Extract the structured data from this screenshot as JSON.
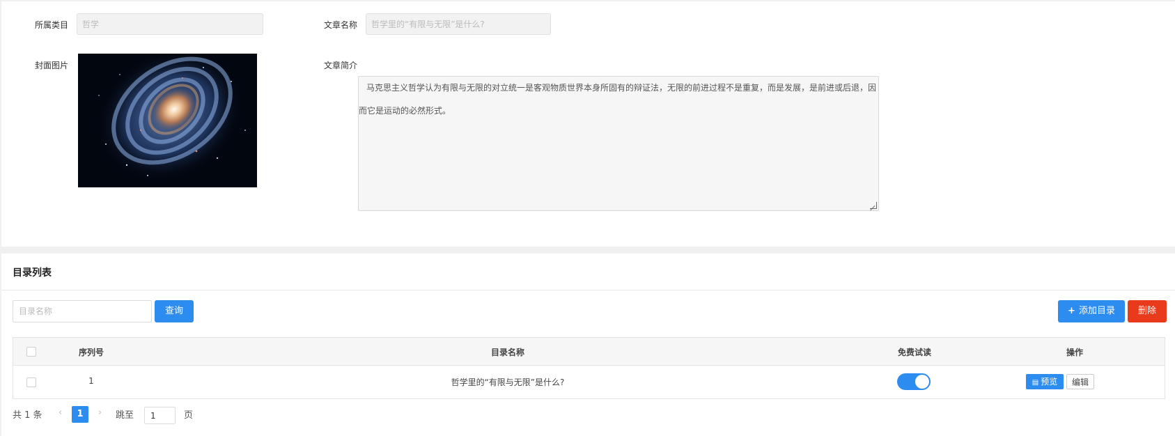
{
  "form": {
    "category_label": "所属类目",
    "category_value": "哲学",
    "title_label": "文章名称",
    "title_value": "哲学里的“有限与无限”是什么?",
    "cover_label": "封面图片",
    "intro_label": "文章简介",
    "intro_text": "马克思主义哲学认为有限与无限的对立统一是客观物质世界本身所固有的辩证法，无限的前进过程不是重复，而是发展，是前进或后退，因而它是运动的必然形式。"
  },
  "catalog": {
    "section_title": "目录列表",
    "search_placeholder": "目录名称",
    "query_label": "查询",
    "add_label": "添加目录",
    "delete_label": "删除",
    "columns": [
      "序列号",
      "目录名称",
      "免费试读",
      "操作"
    ],
    "rows": [
      {
        "seq": "1",
        "name": "哲学里的“有限与无限”是什么?",
        "free_trial": true,
        "preview_label": "预览",
        "edit_label": "编辑"
      }
    ]
  },
  "pagination": {
    "total_text": "共 1 条",
    "current_page": "1",
    "jump_label": "跳至",
    "jump_value": "1",
    "page_suffix": "页"
  },
  "colors": {
    "primary": "#2d8cf0",
    "danger": "#ea3a1c"
  }
}
